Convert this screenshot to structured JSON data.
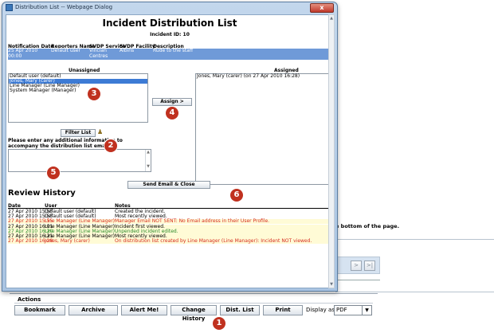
{
  "window": {
    "title": "Distribution List -- Webpage Dialog",
    "close_label": "x"
  },
  "dialog": {
    "title": "Incident Distribution List",
    "incident_id": "Incident ID: 10",
    "notification": {
      "headers": [
        "Notification Date",
        "Reporters Name",
        "SVDP Service",
        "SVDP Facility",
        "Description"
      ],
      "row": {
        "date": "25 Apr 2010\n00:00",
        "reporter": "Default user",
        "service": "Vincian\nCentres",
        "facility": "Albins",
        "description": "Rude to the staff"
      }
    },
    "unassigned": {
      "header": "Unassigned",
      "items": [
        "Default user (default)",
        "Jones, Mary (carer)",
        "Line Manager (Line Manager)",
        "System Manager (Manager)"
      ],
      "selected_index": 1
    },
    "assign_button": "Assign >",
    "assigned": {
      "header": "Assigned",
      "items": [
        "Jones, Mary (carer) (on 27 Apr 2010 16:28)"
      ]
    },
    "filter_button": "Filter List",
    "filter_icon": "user-icon",
    "email_label": "Please enter any additional information to accompany the distribution list email:",
    "email_value": "",
    "send_button": "Send Email & Close",
    "review": {
      "title": "Review History",
      "headers": [
        "Date",
        "User",
        "Notes"
      ],
      "rows": [
        {
          "date": "27 Apr 2010 15:55",
          "user": "Default user (default)",
          "note": "Created the incident.",
          "bg": "#ffffff",
          "color": "#000000"
        },
        {
          "date": "27 Apr 2010 15:55",
          "user": "Default user (default)",
          "note": "Most recently viewed.",
          "bg": "#ffffff",
          "color": "#000000"
        },
        {
          "date": "27 Apr 2010 15:55",
          "user": "Line Manager (Line Manager)",
          "note": "Manager Email NOT SENT: No Email address in their User Profile.",
          "bg": "#fffbd6",
          "color": "#d62d20"
        },
        {
          "date": "27 Apr 2010 16:01",
          "user": "Line Manager (Line Manager)",
          "note": "Incident first viewed.",
          "bg": "#fffbd6",
          "color": "#000000"
        },
        {
          "date": "27 Apr 2010 16:20",
          "user": "Line Manager (Line Manager)",
          "note": "Unpended incident edited.",
          "bg": "#fffbd6",
          "color": "#2a8a2a"
        },
        {
          "date": "27 Apr 2010 16:21",
          "user": "Line Manager (Line Manager)",
          "note": "Most recently viewed.",
          "bg": "#fffbd6",
          "color": "#000000"
        },
        {
          "date": "27 Apr 2010 16:28",
          "user": "Jones, Mary (carer)",
          "note": "On distribution list created by Line Manager (Line Manager): Incident NOT viewed.",
          "bg": "#fffbd6",
          "color": "#d62d20"
        }
      ]
    }
  },
  "background": {
    "hint_text": "e bottom of the page.",
    "nav_next": ">",
    "nav_last": ">|",
    "actions": {
      "title": "Actions",
      "buttons": [
        "Bookmark",
        "Archive",
        "Alert Me!",
        "Change History",
        "Dist. List",
        "Print"
      ],
      "display_label": "Display as:",
      "display_value": "PDF"
    }
  },
  "markers": [
    "1",
    "2",
    "3",
    "4",
    "5",
    "6"
  ],
  "colors": {
    "marker": "#c0311f",
    "selected_row": "#6f9ad8",
    "list_selection": "#3d7bd5"
  }
}
